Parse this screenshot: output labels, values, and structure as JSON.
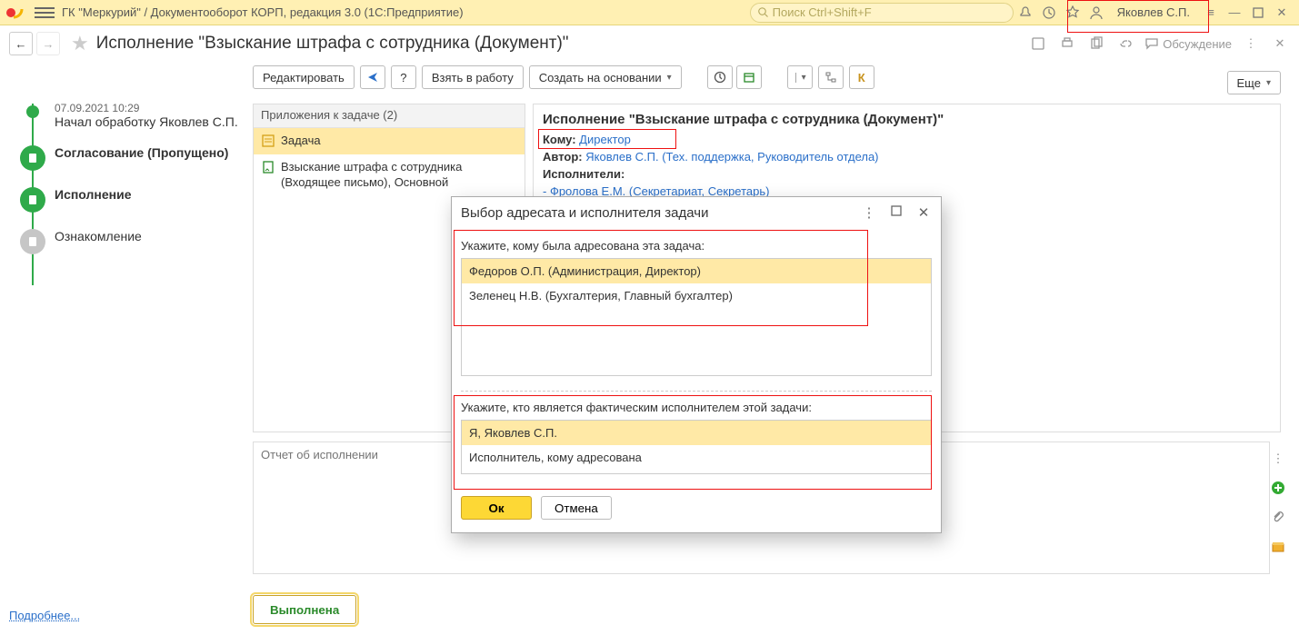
{
  "titlebar": {
    "title": "ГК \"Меркурий\" / Документооборот КОРП, редакция 3.0  (1С:Предприятие)",
    "search_placeholder": "Поиск Ctrl+Shift+F",
    "user": "Яковлев С.П."
  },
  "header": {
    "title": "Исполнение \"Взыскание штрафа с сотрудника (Документ)\"",
    "discuss": "Обсуждение"
  },
  "toolbar": {
    "edit": "Редактировать",
    "take": "Взять в работу",
    "create_base": "Создать на основании",
    "k": "К",
    "more": "Еще"
  },
  "timeline": {
    "items": [
      {
        "meta": "07.09.2021 10:29",
        "text": "Начал обработку Яковлев С.П."
      },
      {
        "label": "Согласование (Пропущено)"
      },
      {
        "label": "Исполнение"
      },
      {
        "label": "Ознакомление"
      }
    ]
  },
  "attach": {
    "header": "Приложения к задаче (2)",
    "items": [
      {
        "text": "Задача"
      },
      {
        "text": "Взыскание штрафа с сотрудника (Входящее письмо), Основной"
      }
    ]
  },
  "detail": {
    "title": "Исполнение \"Взыскание штрафа с сотрудника (Документ)\"",
    "to_label": "Кому:",
    "to_value": "Директор",
    "author_label": "Автор:",
    "author_value": "Яковлев С.П. (Тех. поддержка, Руководитель отдела)",
    "exec_label": "Исполнители:",
    "exec_value": "- Фролова Е.М. (Секретариат, Секретарь)"
  },
  "report": {
    "placeholder": "Отчет об исполнении"
  },
  "done_button": "Выполнена",
  "more_link": "Подробнее...",
  "dialog": {
    "title": "Выбор адресата и исполнителя задачи",
    "label1": "Укажите, кому была адресована эта задача:",
    "opts1": [
      "Федоров О.П. (Администрация, Директор)",
      "Зеленец Н.В. (Бухгалтерия, Главный бухгалтер)"
    ],
    "label2": "Укажите, кто является фактическим исполнителем этой задачи:",
    "opts2": [
      "Я, Яковлев С.П.",
      "Исполнитель, кому адресована"
    ],
    "ok": "Ок",
    "cancel": "Отмена"
  }
}
